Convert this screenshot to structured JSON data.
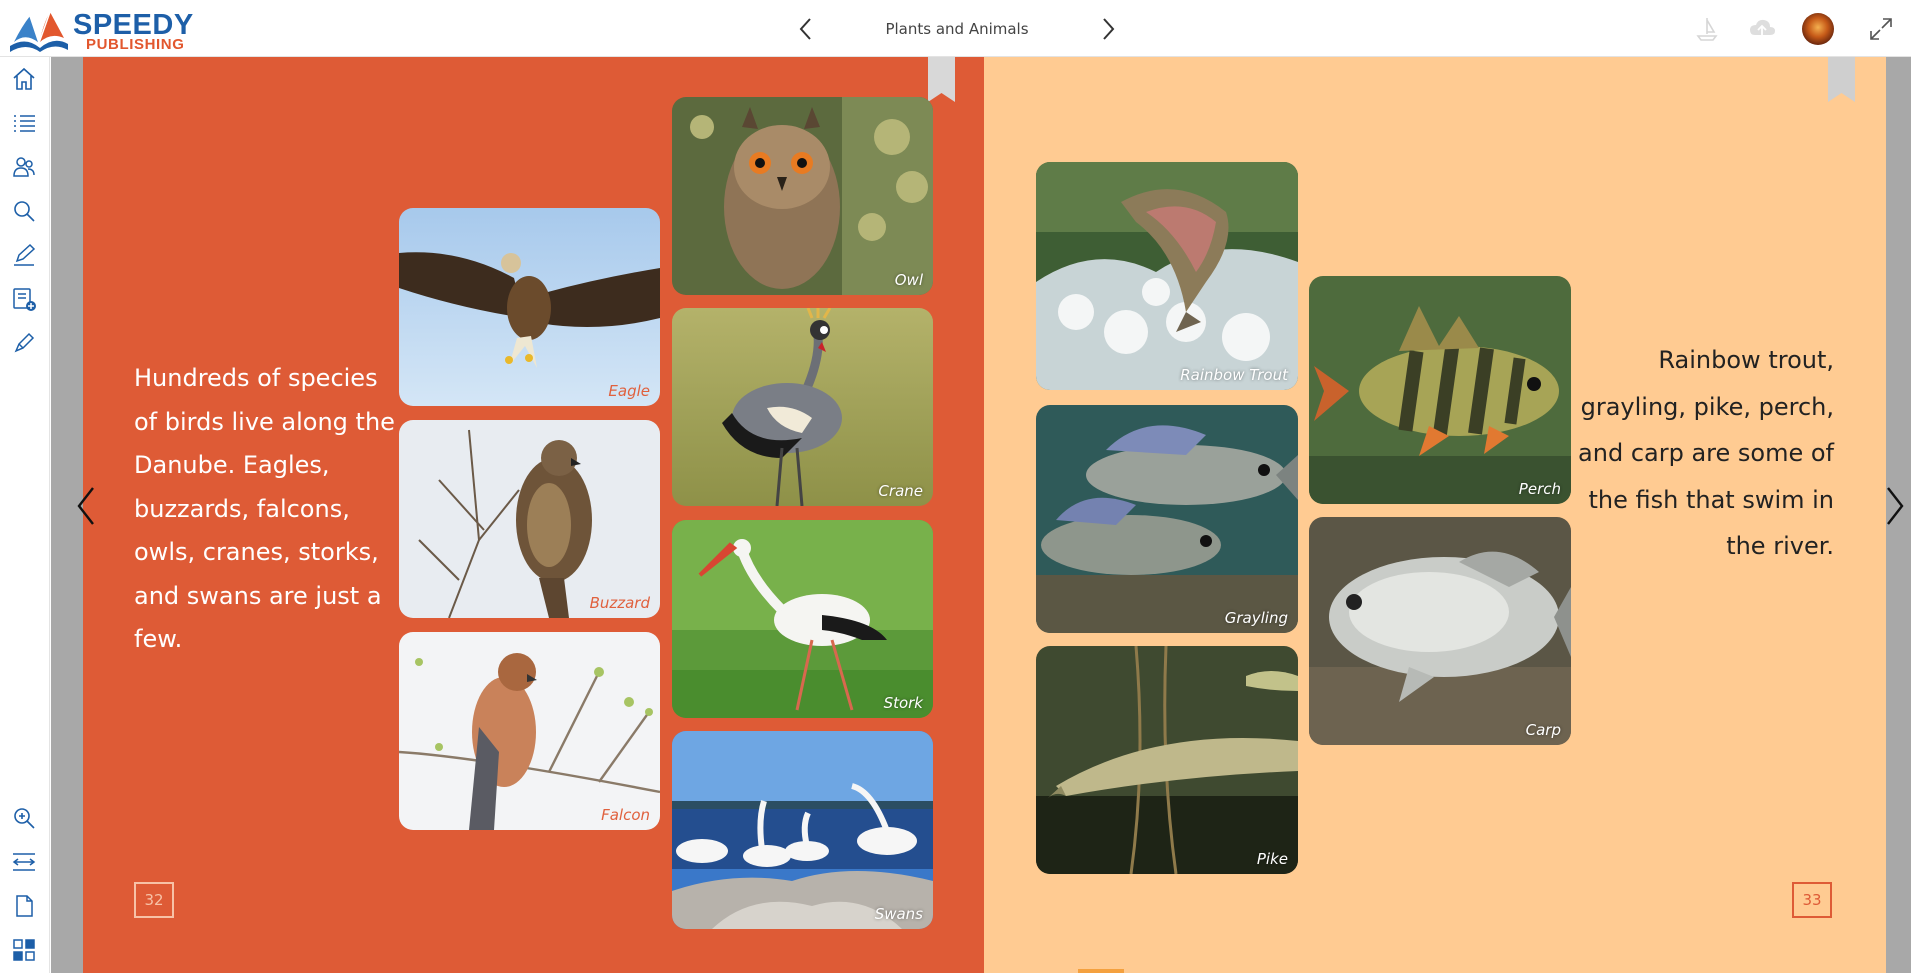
{
  "brand": {
    "name_top": "SPEEDY",
    "name_bottom": "PUBLISHING",
    "accent_blue": "#1d5fa8",
    "accent_orange": "#e2572e"
  },
  "header": {
    "title": "Plants and Animals",
    "prev_icon": "chevron-left-icon",
    "next_icon": "chevron-right-icon",
    "right_icons": [
      "sailboat-icon",
      "cloud-upload-icon",
      "user-avatar",
      "fullscreen-icon"
    ]
  },
  "sidebar": {
    "top_items": [
      "home-icon",
      "table-of-contents-icon",
      "people-icon",
      "search-icon",
      "annotate-icon",
      "add-note-icon",
      "highlighter-icon"
    ],
    "bottom_items": [
      "zoom-in-icon",
      "fit-width-icon",
      "single-page-icon",
      "thumbnails-icon"
    ]
  },
  "left_page": {
    "background": "#de5b36",
    "paragraph": "Hundreds of species of birds live along the Danube. Eagles, buzzards, falcons, owls, cranes, storks, and swans are just a few.",
    "page_number": "32",
    "photos": [
      {
        "id": "eagle",
        "caption": "Eagle"
      },
      {
        "id": "buzzard",
        "caption": "Buzzard"
      },
      {
        "id": "falcon",
        "caption": "Falcon"
      },
      {
        "id": "owl",
        "caption": "Owl"
      },
      {
        "id": "crane",
        "caption": "Crane"
      },
      {
        "id": "stork",
        "caption": "Stork"
      },
      {
        "id": "swans",
        "caption": "Swans"
      }
    ]
  },
  "right_page": {
    "background": "#ffcb92",
    "paragraph": "Rainbow trout, grayling, pike, perch, and carp are some of the fish that swim in the river.",
    "page_number": "33",
    "photos": [
      {
        "id": "rainbow-trout",
        "caption": "Rainbow Trout"
      },
      {
        "id": "grayling",
        "caption": "Grayling"
      },
      {
        "id": "pike",
        "caption": "Pike"
      },
      {
        "id": "perch",
        "caption": "Perch"
      },
      {
        "id": "carp",
        "caption": "Carp"
      }
    ]
  }
}
